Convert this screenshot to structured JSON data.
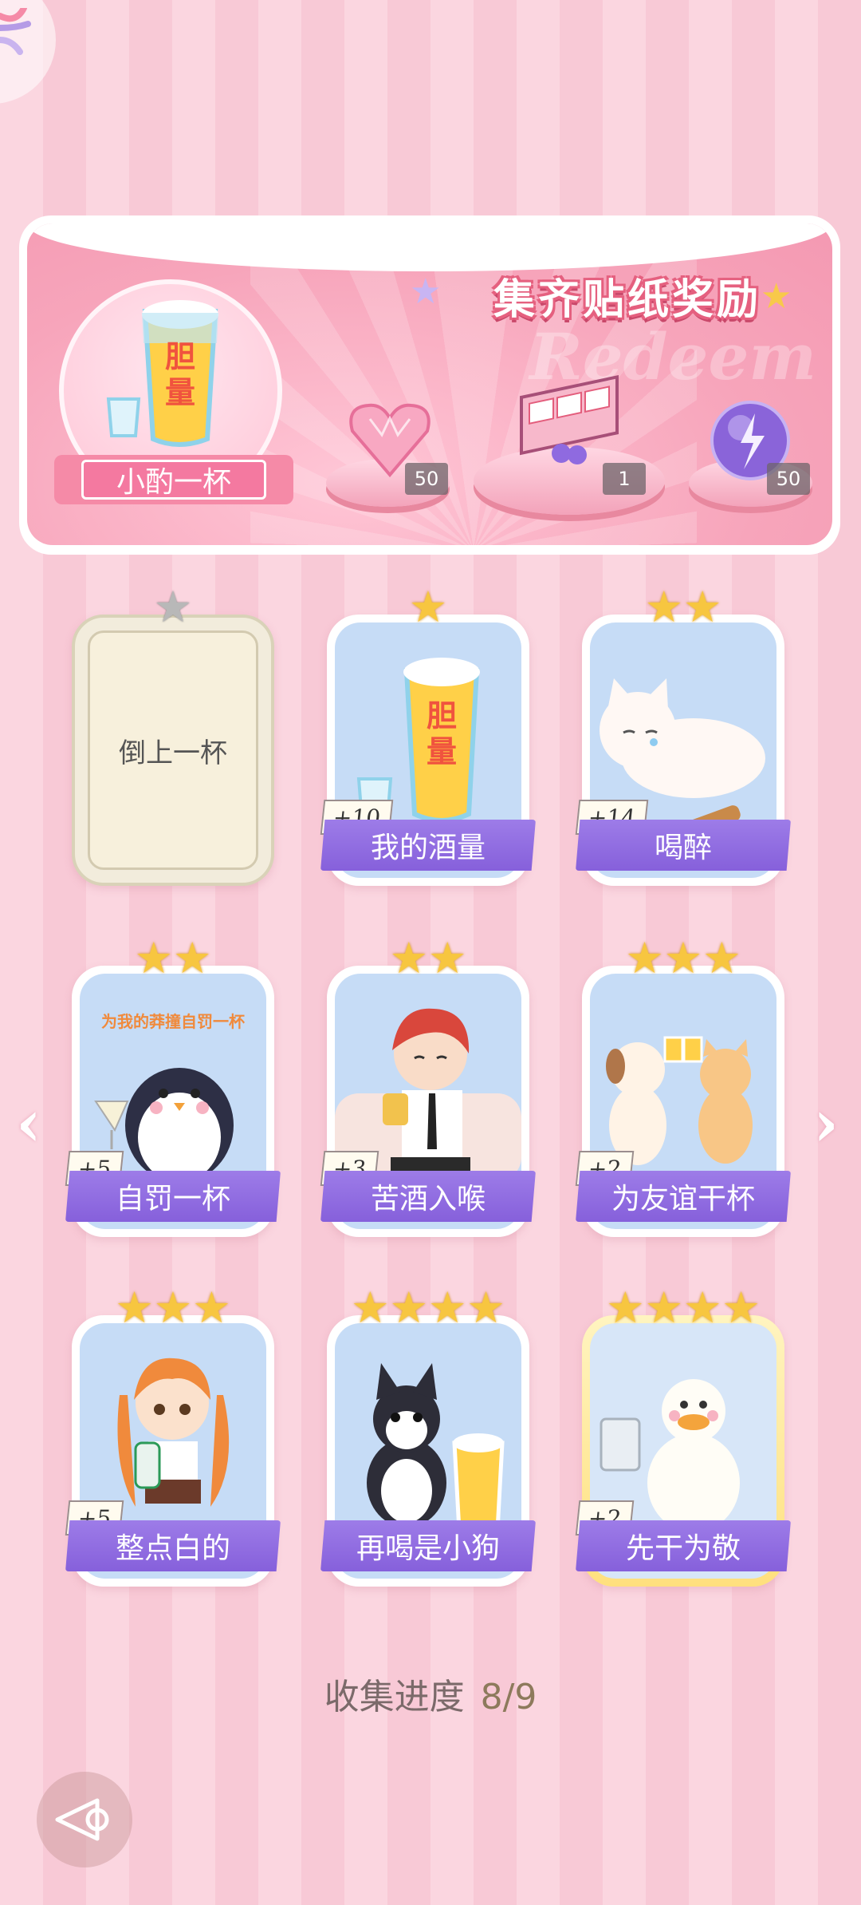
{
  "banner": {
    "title": "集齐贴纸奖励",
    "feature_label": "小酌一杯",
    "glass_text": "胆量",
    "rewards": [
      {
        "name": "heart-gem",
        "qty": "50"
      },
      {
        "name": "gift-box",
        "qty": "1"
      },
      {
        "name": "lightning-orb",
        "qty": "50"
      }
    ]
  },
  "cards": [
    {
      "title": "倒上一杯",
      "stars": 1,
      "plus": "",
      "locked": true
    },
    {
      "title": "我的酒量",
      "stars": 1,
      "plus": "+10"
    },
    {
      "title": "喝醉",
      "stars": 2,
      "plus": "+14"
    },
    {
      "title": "自罚一杯",
      "stars": 2,
      "plus": "+5",
      "caption": "为我的莽撞自罚一杯"
    },
    {
      "title": "苦酒入喉",
      "stars": 2,
      "plus": "+3"
    },
    {
      "title": "为友谊干杯",
      "stars": 3,
      "plus": "+2"
    },
    {
      "title": "整点白的",
      "stars": 3,
      "plus": "+5"
    },
    {
      "title": "再喝是小狗",
      "stars": 4,
      "plus": ""
    },
    {
      "title": "先干为敬",
      "stars": 4,
      "plus": "+2"
    }
  ],
  "progress": {
    "label": "收集进度",
    "value": "8/9"
  },
  "colors": {
    "accent_purple": "#8660db",
    "star_gold": "#f7c640",
    "bg_pink": "#fbd6e0"
  }
}
